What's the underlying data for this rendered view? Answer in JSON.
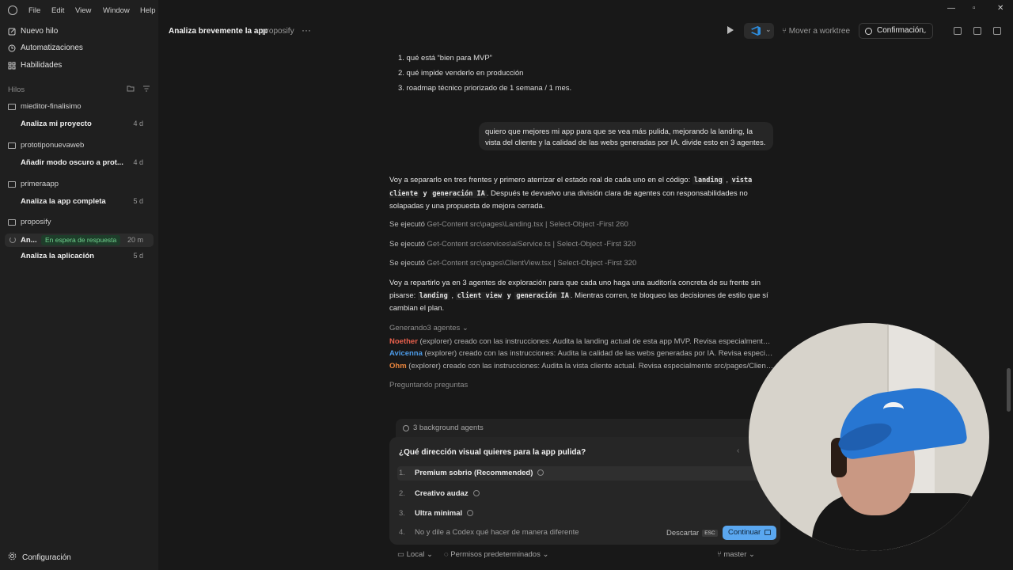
{
  "menubar": {
    "items": [
      "File",
      "Edit",
      "View",
      "Window",
      "Help"
    ]
  },
  "sidebar": {
    "nav": [
      {
        "label": "Nuevo hilo",
        "icon": "edit-icon"
      },
      {
        "label": "Automatizaciones",
        "icon": "clock-icon"
      },
      {
        "label": "Habilidades",
        "icon": "grid-icon"
      }
    ],
    "threads_label": "Hilos",
    "projects": [
      {
        "name": "mieditor-finalisimo",
        "threads": [
          {
            "title": "Analiza mi proyecto",
            "age": "4 d"
          }
        ]
      },
      {
        "name": "prototiponuevaweb",
        "threads": [
          {
            "title": "Añadir modo oscuro a prot...",
            "age": "4 d"
          }
        ]
      },
      {
        "name": "primeraapp",
        "threads": [
          {
            "title": "Analiza la app completa",
            "age": "5 d"
          }
        ]
      },
      {
        "name": "proposify",
        "threads": [
          {
            "title": "An...",
            "badge": "En espera de respuesta",
            "age": "20 m"
          },
          {
            "title": "Analiza la aplicación",
            "age": "5 d"
          }
        ]
      }
    ],
    "settings_label": "Configuración"
  },
  "header": {
    "title": "Analiza brevemente la app",
    "project": "proposify",
    "move_worktree": "Mover a worktree",
    "confirm": "Confirmación"
  },
  "chat": {
    "list_items": [
      "1. qué está “bien para MVP”",
      "2. qué impide venderlo en producción",
      "3. roadmap técnico priorizado de 1 semana / 1 mes."
    ],
    "user_message": "quiero que mejores mi app para que se vea más pulida, mejorando la landing, la vista del cliente y la calidad de las webs generadas por IA. divide esto en 3 agentes.",
    "para1": {
      "a": "Voy a separarlo en tres frentes y primero aterrizar el estado real de cada uno en el código:",
      "c1": "landing",
      "c2": "vista cliente",
      "c3": "generación IA",
      "b": ". Después te devuelvo una división clara de agentes con responsabilidades no solapadas y una propuesta de mejora cerrada."
    },
    "ran_prefix": "Se ejecutó",
    "commands": [
      "Get-Content src\\pages\\Landing.tsx | Select-Object -First 260",
      "Get-Content src\\services\\aiService.ts | Select-Object -First 320",
      "Get-Content src\\pages\\ClientView.tsx | Select-Object -First 320"
    ],
    "para2": {
      "a": "Voy a repartirlo ya en 3 agentes de exploración para que cada uno haga una auditoría concreta de su frente sin pisarse:",
      "c1": "landing",
      "c2": "client view",
      "c3": "generación IA",
      "b": ". Mientras corren, te bloqueo las decisiones de estilo que sí cambian el plan."
    },
    "generating": "Generando3 agentes",
    "agents": [
      {
        "name": "Noether",
        "color": "#e8604c",
        "text": " (explorer) creado con las instrucciones: Audita la landing actual de esta app MVP. Revisa especialmente src..."
      },
      {
        "name": "Avicenna",
        "color": "#4c9be8",
        "text": " (explorer) creado con las instrucciones: Audita la calidad de las webs generadas por IA. Revisa especialmen..."
      },
      {
        "name": "Ohm",
        "color": "#e8843c",
        "text": " (explorer) creado con las instrucciones: Audita la vista cliente actual. Revisa especialmente src/pages/ClientVie..."
      }
    ],
    "asking": "Preguntando preguntas"
  },
  "question": {
    "bg_agents": "3 background agents",
    "title": "¿Qué dirección visual quieres para la app pulida?",
    "options": [
      {
        "num": "1.",
        "label": "Premium sobrio (Recommended)"
      },
      {
        "num": "2.",
        "label": "Creativo audaz"
      },
      {
        "num": "3.",
        "label": "Ultra minimal"
      }
    ],
    "free_num": "4.",
    "free_placeholder": "No y dile a Codex qué hacer de manera diferente",
    "dismiss": "Descartar",
    "dismiss_key": "ESC",
    "continue": "Continuar"
  },
  "footer": {
    "local": "Local",
    "permissions": "Permisos predeterminados",
    "branch": "master"
  }
}
